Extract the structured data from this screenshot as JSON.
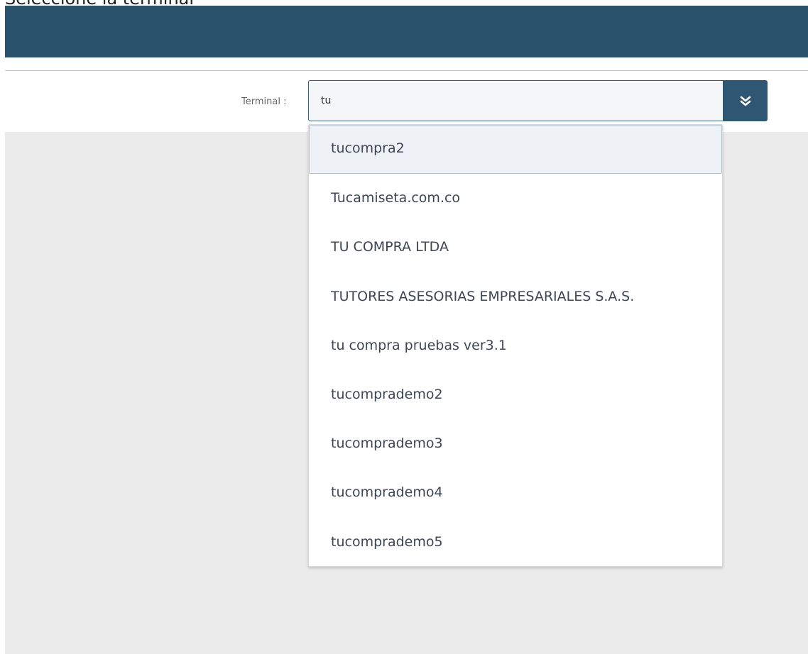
{
  "page": {
    "title": "Seleccione la terminal"
  },
  "form": {
    "terminal_label": "Terminal :",
    "terminal_value": "tu"
  },
  "dropdown": {
    "toggle_icon": "double-chevron-down-icon",
    "items": [
      {
        "label": "tucompra2",
        "selected": true
      },
      {
        "label": "Tucamiseta.com.co",
        "selected": false
      },
      {
        "label": "TU COMPRA LTDA",
        "selected": false
      },
      {
        "label": "TUTORES ASESORIAS EMPRESARIALES S.A.S.",
        "selected": false
      },
      {
        "label": "tu compra pruebas ver3.1",
        "selected": false
      },
      {
        "label": "tucomprademo2",
        "selected": false
      },
      {
        "label": "tucomprademo3",
        "selected": false
      },
      {
        "label": "tucomprademo4",
        "selected": false
      },
      {
        "label": "tucomprademo5",
        "selected": false
      }
    ]
  },
  "colors": {
    "header_bar": "#2a526c",
    "toggle_button": "#2f5673",
    "content_background": "#ebebeb",
    "selected_item_background": "#eef2f6"
  }
}
